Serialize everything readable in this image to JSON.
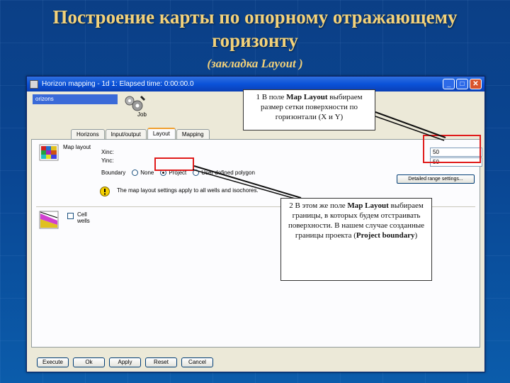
{
  "slide": {
    "title_line1": "Построение карты по опорному отражающему",
    "title_line2": "горизонту",
    "subtitle": "(закладка Layout )"
  },
  "window": {
    "title": "Horizon mapping - 1d 1: Elapsed time: 0:00:00.0",
    "controls": [
      "_",
      "□",
      "✕"
    ],
    "horizons_label": "orizons",
    "job_label": "Job"
  },
  "tabs": [
    "Horizons",
    "Input/output",
    "Layout",
    "Mapping"
  ],
  "active_tab": "Layout",
  "map_layout": {
    "section_label": "Map layout",
    "xinc_label": "Xinc:",
    "yinc_label": "Yinc:",
    "xinc_value": "50",
    "yinc_value": "50",
    "boundary_label": "Boundary",
    "options": [
      "None",
      "Project",
      "User defined polygon"
    ],
    "selected_option": "Project",
    "detailed_button": "Detailed range settings...",
    "warning_text": "The map layout settings apply to all wells and isochores."
  },
  "second_section": {
    "label": "Cell",
    "sub_label": "wells"
  },
  "bottom_buttons": [
    "Execute",
    "Ok",
    "Apply",
    "Reset",
    "Cancel"
  ],
  "callout1": {
    "part1": "1 В поле ",
    "bold1": "Map Layout",
    "part2": " выбираем размер сетки  поверхности по горизонтали (X и Y)"
  },
  "callout2": {
    "part1": "2 В этом же поле ",
    "bold1": "Map Layout",
    "part2": " выбираем границы, в которых будем отстраивать поверхности. В нашем случае созданные границы проекта (",
    "bold2": "Project boundary",
    "part3": ")"
  },
  "colors": {
    "title_text": "#f3d27a",
    "highlight": "#e01b1b",
    "titlebar": "#0a52d8"
  }
}
